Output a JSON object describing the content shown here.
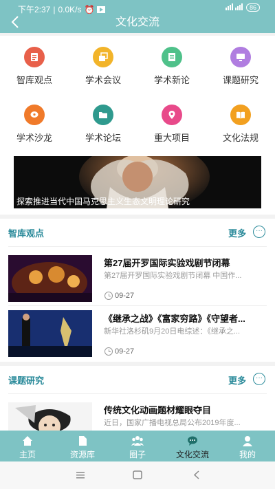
{
  "status_bar": {
    "time": "下午2:37",
    "speed": "0.0K/s",
    "battery": "86"
  },
  "header": {
    "title": "文化交流"
  },
  "categories": [
    {
      "label": "智库观点",
      "color": "#e8604a",
      "icon": "document-icon"
    },
    {
      "label": "学术会议",
      "color": "#f2b42a",
      "icon": "windows-icon"
    },
    {
      "label": "学术新论",
      "color": "#4fc18a",
      "icon": "notepad-icon"
    },
    {
      "label": "课题研究",
      "color": "#b07de0",
      "icon": "monitor-icon"
    },
    {
      "label": "学术沙龙",
      "color": "#f07a2a",
      "icon": "chat-icon"
    },
    {
      "label": "学术论坛",
      "color": "#2f9a8e",
      "icon": "folder-icon"
    },
    {
      "label": "重大项目",
      "color": "#e84a8a",
      "icon": "location-icon"
    },
    {
      "label": "文化法规",
      "color": "#f2a020",
      "icon": "book-icon"
    }
  ],
  "banner": {
    "caption": "探索推进当代中国马克思主义生态文明理论研究"
  },
  "section1": {
    "title": "智库观点",
    "more": "更多",
    "items": [
      {
        "title": "第27届开罗国际实验戏剧节闭幕",
        "summary": "第27届开罗国际实验戏剧节闭幕 中国作...",
        "date": "09-27"
      },
      {
        "title": "《继承之战》《富家穷路》《守望者...",
        "summary": "新华社洛杉矶9月20日电综述：《继承之...",
        "date": "09-27"
      }
    ]
  },
  "section2": {
    "title": "课题研究",
    "more": "更多",
    "items": [
      {
        "title": "传统文化动画题材耀眼夺目",
        "summary": "近日，国家广播电视总局公布2019年度..."
      }
    ]
  },
  "tabs": [
    {
      "label": "主页",
      "icon": "home-icon"
    },
    {
      "label": "资源库",
      "icon": "file-icon"
    },
    {
      "label": "圈子",
      "icon": "group-icon"
    },
    {
      "label": "文化交流",
      "icon": "chat-bubble-icon",
      "active": true
    },
    {
      "label": "我的",
      "icon": "person-icon"
    }
  ]
}
